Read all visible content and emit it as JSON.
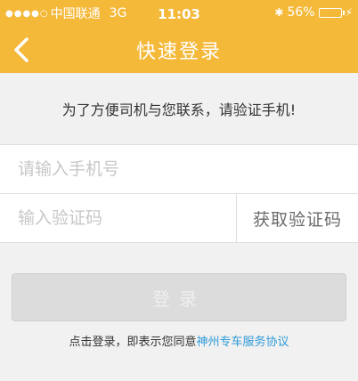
{
  "status_bar": {
    "signal": "●●●●○",
    "carrier": "中国联通",
    "network": "3G",
    "time": "11:03",
    "bluetooth": "✱",
    "battery_percent_label": "56%",
    "battery_level": 0.56
  },
  "nav": {
    "back_icon": "chevron-left",
    "title": "快速登录"
  },
  "notice": "为了方便司机与您联系，请验证手机!",
  "form": {
    "phone_placeholder": "请输入手机号",
    "code_placeholder": "输入验证码",
    "get_code_label": "获取验证码"
  },
  "login_button": "登录",
  "agreement": {
    "prefix": "点击登录，即表示您同意",
    "link": "神州专车服务协议"
  },
  "colors": {
    "brand": "#f5b93a",
    "link": "#2f9bd8",
    "disabled_button": "#dcdcdc"
  }
}
